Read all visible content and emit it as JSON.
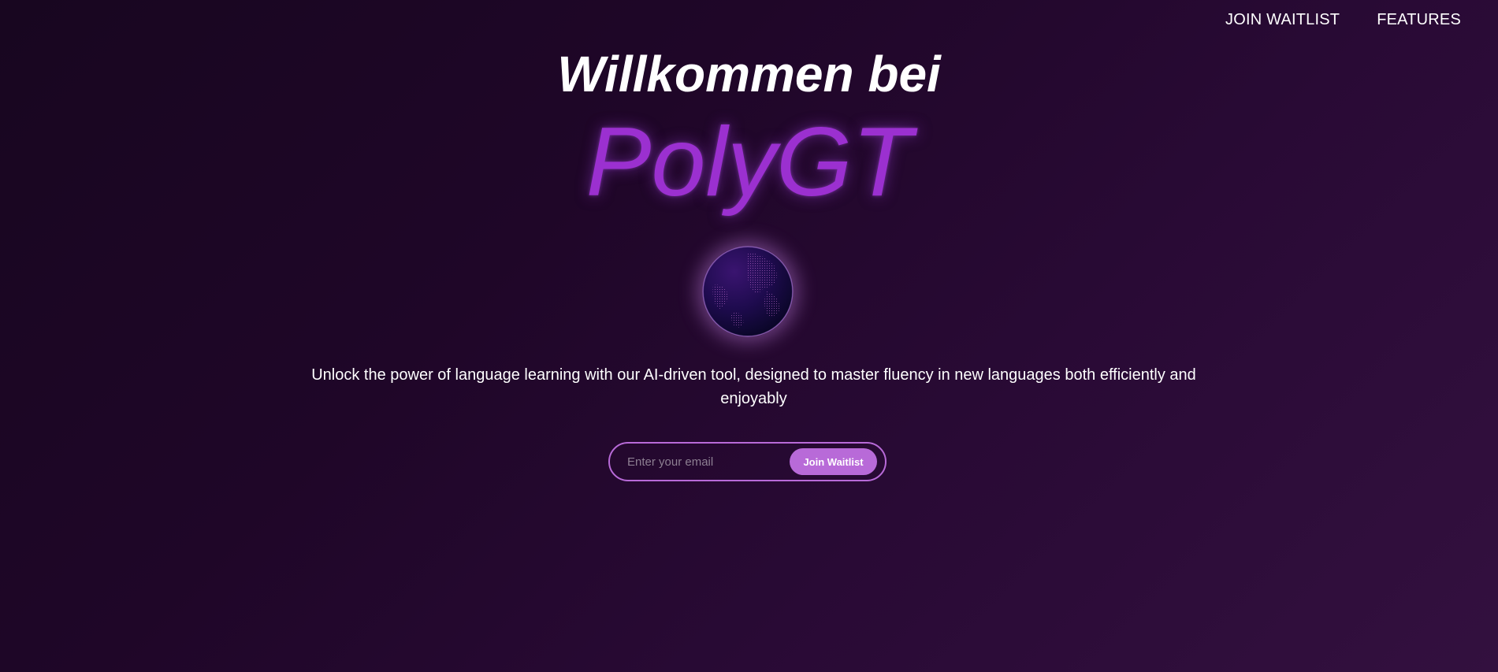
{
  "nav": {
    "items": [
      {
        "label": "JOIN WAITLIST"
      },
      {
        "label": "FEATURES"
      }
    ]
  },
  "hero": {
    "welcome": "Willkommen bei",
    "brand": "PolyGT",
    "tagline": "Unlock the power of language learning with our AI-driven tool, designed to master fluency in new languages both efficiently and enjoyably"
  },
  "signup": {
    "email_placeholder": "Enter your email",
    "email_value": "",
    "button_label": "Join Waitlist"
  },
  "icons": {
    "globe": "globe-icon"
  },
  "colors": {
    "background_start": "#180620",
    "background_end": "#33103f",
    "brand": "#9b30d0",
    "accent": "#b86ad8",
    "text": "#ffffff",
    "placeholder": "#8d7f92"
  }
}
